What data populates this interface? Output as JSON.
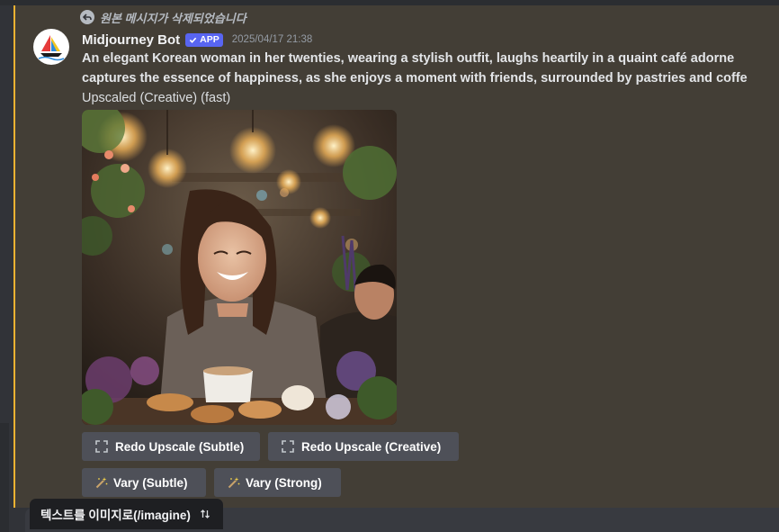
{
  "reply": {
    "icon": "reply-arrow-icon",
    "text": "원본 메시지가 삭제되었습니다"
  },
  "message": {
    "avatar_icon": "midjourney-sailboat-logo",
    "username": "Midjourney Bot",
    "badge": "APP",
    "badge_icon": "checkmark-icon",
    "timestamp": "2025/04/17 21:38",
    "prompt_line1": "An elegant Korean woman in her twenties, wearing a stylish outfit, laughs heartily in a quaint café adorne",
    "prompt_line2": "captures the essence of happiness, as she enjoys a moment with friends, surrounded by pastries and coffe",
    "suffix": "Upscaled (Creative) (fast)"
  },
  "buttons": {
    "redo_subtle": "Redo Upscale (Subtle)",
    "redo_creative": "Redo Upscale (Creative)",
    "vary_subtle": "Vary (Subtle)",
    "vary_strong": "Vary (Strong)"
  },
  "chat": {
    "command_label": "텍스트를 이미지로(/imagine)",
    "command_icon": "sort-arrows-icon"
  },
  "colors": {
    "highlight_bg": "#433e36",
    "highlight_border": "#f0b232",
    "badge": "#5865f2",
    "button": "#4e5058"
  }
}
